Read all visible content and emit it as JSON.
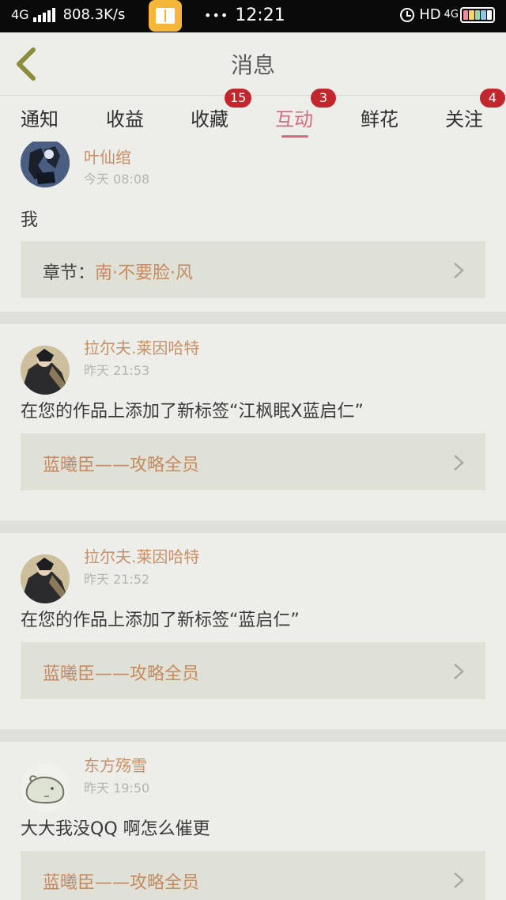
{
  "status_bar": {
    "network": "4G",
    "speed": "808.3K/s",
    "dots": "•••",
    "time": "12:21",
    "hd": "HD",
    "net_right": "4G"
  },
  "header": {
    "title": "消息",
    "back_icon": "chevron-left-icon"
  },
  "tabs": [
    {
      "label": "通知",
      "badge": ""
    },
    {
      "label": "收益",
      "badge": ""
    },
    {
      "label": "收藏",
      "badge": "15"
    },
    {
      "label": "互动",
      "badge": "3",
      "active": true
    },
    {
      "label": "鲜花",
      "badge": ""
    },
    {
      "label": "关注",
      "badge": "4"
    }
  ],
  "colors": {
    "accent": "#d66b80",
    "badge": "#c2272d",
    "username": "#c89067",
    "link_title": "#c78a60",
    "background": "#ededea",
    "link_box": "#dfe1d7"
  },
  "messages": [
    {
      "user": "叶仙绾",
      "time": "今天 08:08",
      "text": "我",
      "link_prefix": "章节：",
      "link_title": "南·不要脸·风"
    },
    {
      "user": "拉尔夫.莱因哈特",
      "time": "昨天 21:53",
      "text": "在您的作品上添加了新标签“江枫眠X蓝启仁”",
      "link_prefix": "",
      "link_title": "蓝曦臣——攻略全员"
    },
    {
      "user": "拉尔夫.莱因哈特",
      "time": "昨天 21:52",
      "text": "在您的作品上添加了新标签“蓝启仁”",
      "link_prefix": "",
      "link_title": "蓝曦臣——攻略全员"
    },
    {
      "user": "东方殇雪",
      "time": "昨天 19:50",
      "text": "大大我没QQ 啊怎么催更",
      "link_prefix": "",
      "link_title": "蓝曦臣——攻略全员"
    }
  ]
}
